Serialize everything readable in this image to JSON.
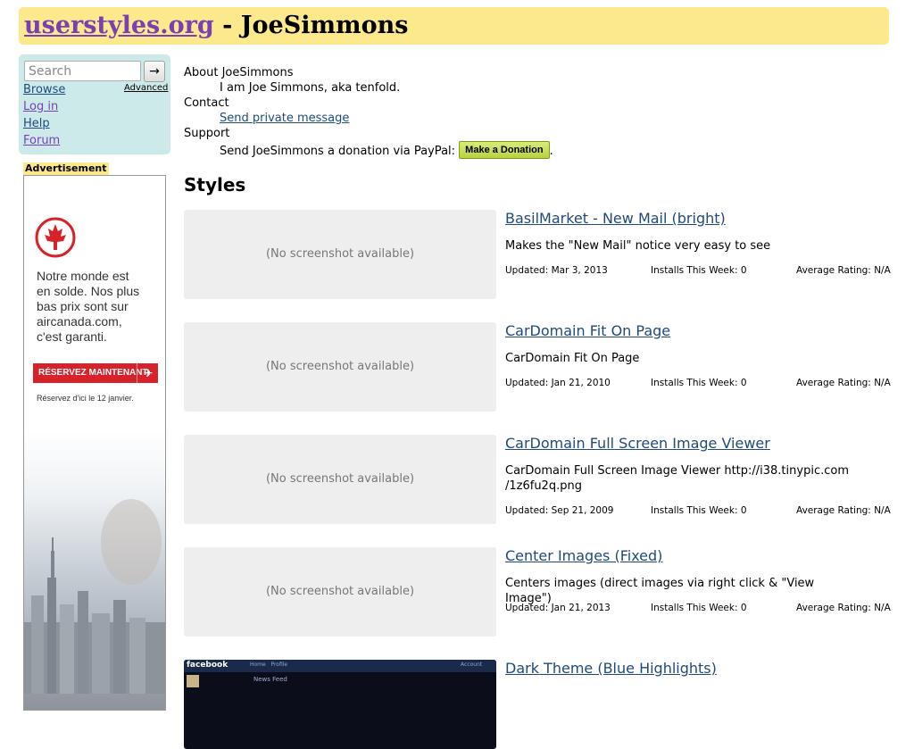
{
  "header": {
    "site": "userstyles.org",
    "separator": " - ",
    "user": "JoeSimmons"
  },
  "nav": {
    "search_placeholder": "Search",
    "search_button": "→",
    "advanced": "Advanced",
    "links": [
      "Browse",
      "Log in",
      "Help",
      "Forum"
    ]
  },
  "ad": {
    "label": "Advertisement",
    "lines": [
      "Notre monde est",
      "en solde. Nos plus",
      "bas prix sont sur",
      "aircanada.com,",
      "c'est garanti."
    ],
    "button": "RÉSERVEZ MAINTENANT",
    "small": "Réservez d'ici le 12 janvier."
  },
  "about": {
    "heading": "About JoeSimmons",
    "bio": "I am Joe Simmons, aka tenfold.",
    "contact_heading": "Contact",
    "contact_link": "Send private message",
    "support_heading": "Support",
    "donation_text": "Send JoeSimmons a donation via PayPal:",
    "donation_button": "Make a Donation",
    "donation_end": "."
  },
  "styles_heading": "Styles",
  "no_screenshot": "(No screenshot available)",
  "meta_labels": {
    "updated": "Updated:",
    "installs": "Installs This Week:",
    "rating": "Average Rating:"
  },
  "styles": [
    {
      "name": "BasilMarket - New Mail (bright)",
      "description": "Makes the \"New Mail\" notice very easy to see",
      "updated": "Mar 3, 2013",
      "installs": "0",
      "rating": "N/A"
    },
    {
      "name": "CarDomain Fit On Page",
      "description": "CarDomain Fit On Page",
      "updated": "Jan 21, 2010",
      "installs": "0",
      "rating": "N/A"
    },
    {
      "name": "CarDomain Full Screen Image Viewer",
      "description": "CarDomain Full Screen Image Viewer http://i38.tinypic.com /1z6fu2q.png",
      "updated": "Sep 21, 2009",
      "installs": "0",
      "rating": "N/A"
    },
    {
      "name": "Center Images (Fixed)",
      "description": "Centers images (direct images via right click & \"View Image\")",
      "updated": "Jan 21, 2013",
      "installs": "0",
      "rating": "N/A"
    },
    {
      "name": "Dark Theme (Blue Highlights)"
    }
  ],
  "thumb": {
    "brand": "facebook",
    "nav": [
      "Home",
      "Profile",
      "Account"
    ],
    "news_feed": "News Feed"
  }
}
